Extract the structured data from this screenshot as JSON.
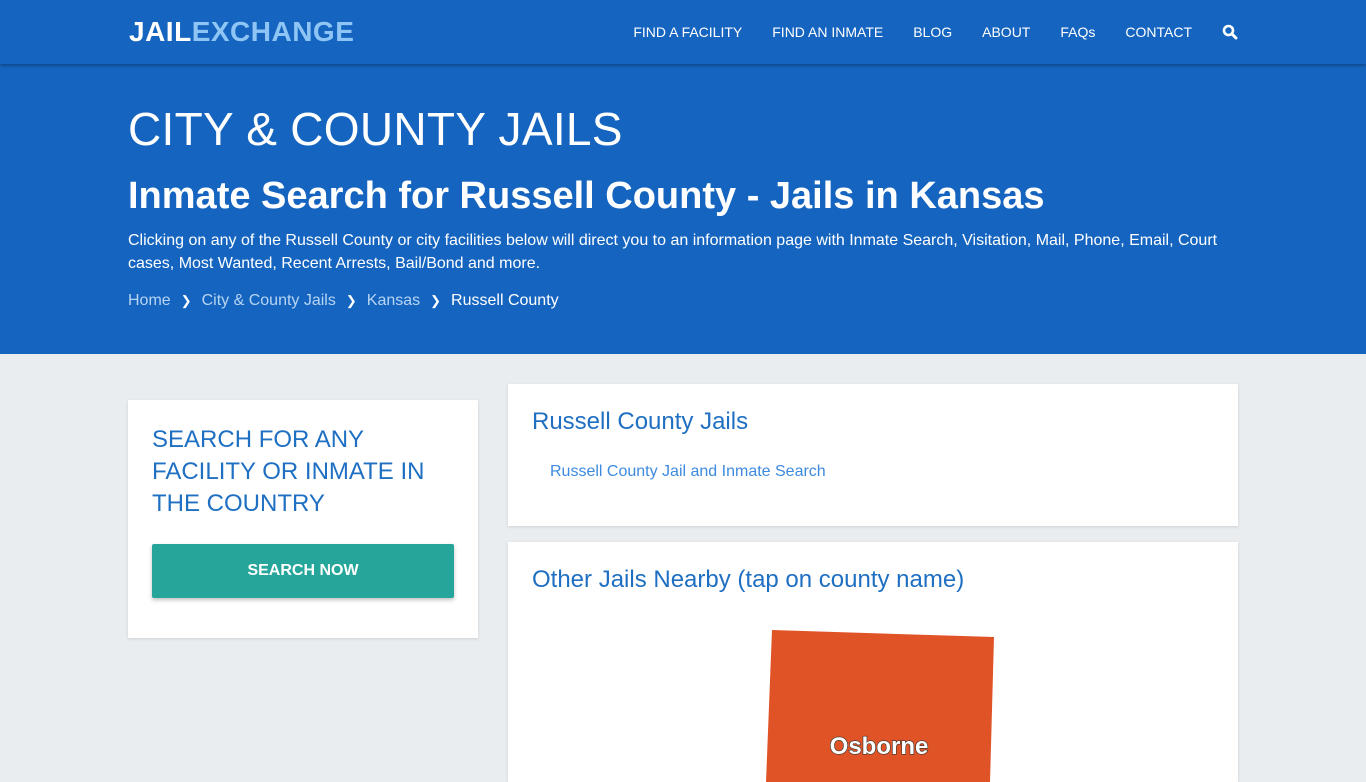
{
  "header": {
    "logo_part1": "JAIL",
    "logo_part2": "EXCHANGE",
    "nav": [
      {
        "label": "FIND A FACILITY"
      },
      {
        "label": "FIND AN INMATE"
      },
      {
        "label": "BLOG"
      },
      {
        "label": "ABOUT"
      },
      {
        "label": "FAQs"
      },
      {
        "label": "CONTACT"
      }
    ],
    "search_icon": "search-icon"
  },
  "hero": {
    "title": "CITY & COUNTY JAILS",
    "subtitle": "Inmate Search for Russell County - Jails in Kansas",
    "description": "Clicking on any of the Russell County or city facilities below will direct you to an information page with Inmate Search, Visitation, Mail, Phone, Email, Court cases, Most Wanted, Recent Arrests, Bail/Bond and more.",
    "breadcrumb": [
      {
        "label": "Home"
      },
      {
        "label": "City & County Jails"
      },
      {
        "label": "Kansas"
      },
      {
        "label": "Russell County"
      }
    ]
  },
  "sidebar": {
    "heading": "SEARCH FOR ANY FACILITY OR INMATE IN THE COUNTRY",
    "button_label": "SEARCH NOW"
  },
  "jails": {
    "heading": "Russell County Jails",
    "links": [
      {
        "label": "Russell County Jail and Inmate Search"
      }
    ]
  },
  "nearby": {
    "heading": "Other Jails Nearby (tap on county name)",
    "counties": [
      {
        "name": "Osborne",
        "color": "#e05327"
      }
    ]
  },
  "colors": {
    "brand_blue": "#1565c0",
    "logo_accent": "#8ec5f5",
    "button_teal": "#26a69a",
    "heading_blue": "#1f6fc2",
    "county_orange": "#e05327"
  }
}
